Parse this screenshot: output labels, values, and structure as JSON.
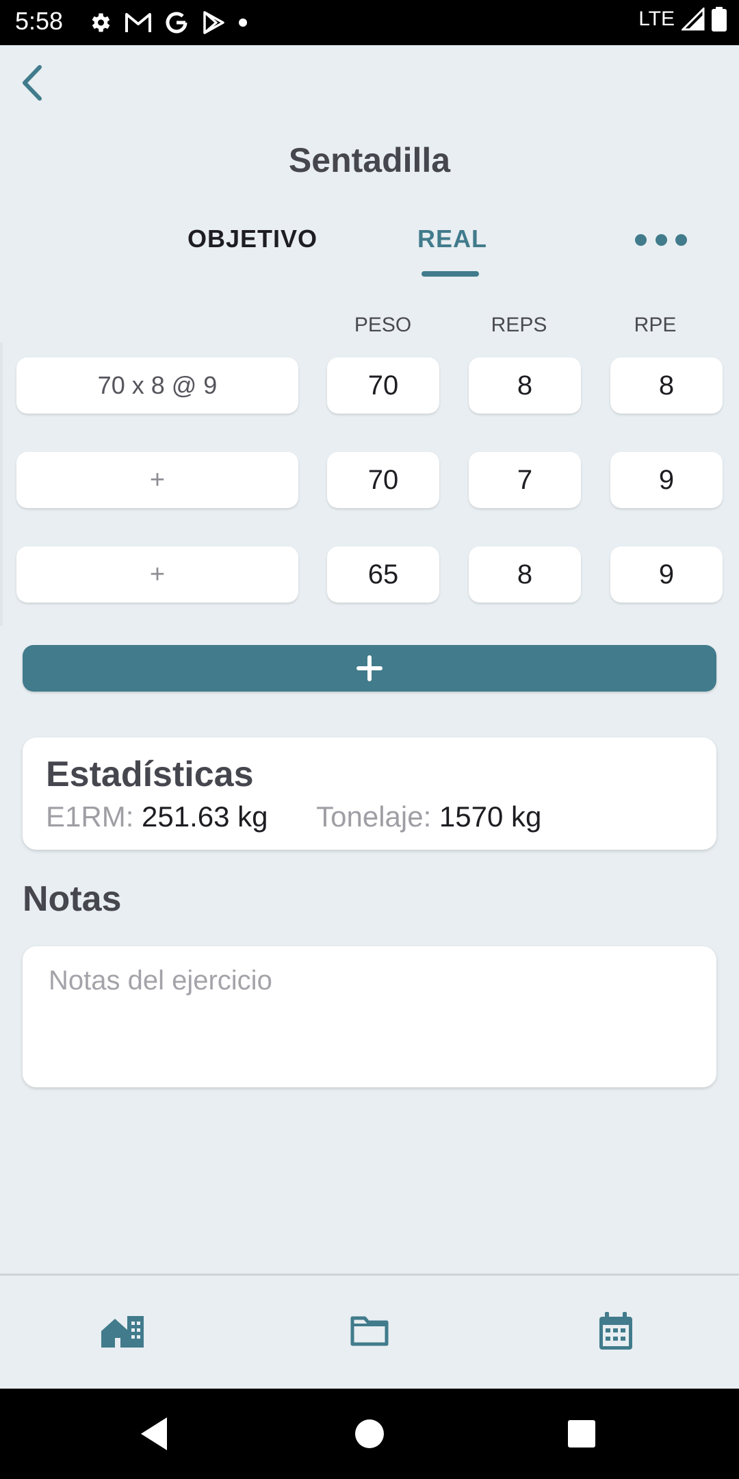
{
  "status_bar": {
    "time": "5:58",
    "network": "LTE",
    "icons": [
      "settings-icon",
      "gmail-icon",
      "google-icon",
      "play-store-icon",
      "notification-dot-icon",
      "signal-icon",
      "battery-icon"
    ]
  },
  "header": {
    "back_icon": "chevron-left-icon",
    "title": "Sentadilla"
  },
  "tabs": [
    {
      "label": "OBJETIVO",
      "active": false
    },
    {
      "label": "REAL",
      "active": true
    }
  ],
  "more_icon": "more-horizontal-icon",
  "columns": {
    "peso": "PESO",
    "reps": "REPS",
    "rpe": "RPE"
  },
  "sets": [
    {
      "target": "70 x 8 @ 9",
      "peso": "70",
      "reps": "8",
      "rpe": "8"
    },
    {
      "target": "+",
      "peso": "70",
      "reps": "7",
      "rpe": "9"
    },
    {
      "target": "+",
      "peso": "65",
      "reps": "8",
      "rpe": "9"
    }
  ],
  "add_set_icon": "plus-icon",
  "stats": {
    "title": "Estadísticas",
    "e1rm_label": "E1RM:",
    "e1rm_value": "251.63 kg",
    "tonnage_label": "Tonelaje:",
    "tonnage_value": "1570 kg"
  },
  "notes": {
    "title": "Notas",
    "placeholder": "Notas del ejercicio",
    "value": ""
  },
  "bottom_nav": [
    "home-icon",
    "folder-icon",
    "calendar-icon"
  ],
  "system_nav": [
    "back-triangle-icon",
    "home-circle-icon",
    "recents-square-icon"
  ],
  "colors": {
    "accent": "#417b8c",
    "background": "#e8eef1",
    "title_text": "#46464e"
  }
}
